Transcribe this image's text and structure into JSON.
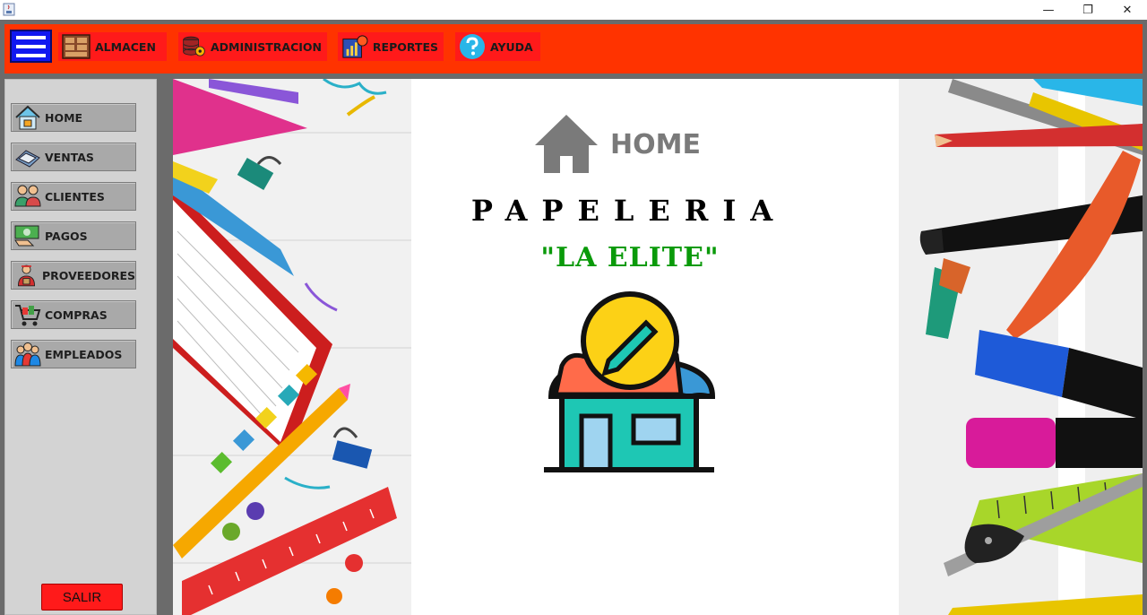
{
  "window": {
    "app_icon": "java-coffee-icon",
    "minimize": "—",
    "restore": "❐",
    "close": "✕"
  },
  "topmenu": {
    "hamburger_icon": "hamburger-menu-icon",
    "items": [
      {
        "label": "ALMACEN",
        "icon": "warehouse-shelves-icon"
      },
      {
        "label": "ADMINISTRACION",
        "icon": "database-gear-icon"
      },
      {
        "label": "REPORTES",
        "icon": "report-chart-icon"
      },
      {
        "label": "AYUDA",
        "icon": "help-question-icon"
      }
    ]
  },
  "sidebar": {
    "items": [
      {
        "label": "HOME",
        "icon": "home-icon"
      },
      {
        "label": "VENTAS",
        "icon": "sales-cash-icon"
      },
      {
        "label": "CLIENTES",
        "icon": "clients-icon"
      },
      {
        "label": "PAGOS",
        "icon": "payments-icon"
      },
      {
        "label": "PROVEEDORES",
        "icon": "supplier-icon"
      },
      {
        "label": "COMPRAS",
        "icon": "shopping-cart-icon"
      },
      {
        "label": "EMPLEADOS",
        "icon": "employees-icon"
      }
    ],
    "exit_label": "SALIR"
  },
  "main": {
    "home_label": "HOME",
    "title": "PAPELERIA",
    "subtitle": "\"LA ELITE\""
  },
  "colors": {
    "menu_bar": "#ff3300",
    "menu_item": "#ff1a1a",
    "hamburger": "#1018f0",
    "sidebar": "#d3d3d3",
    "subtitle": "#0a9a0a"
  }
}
